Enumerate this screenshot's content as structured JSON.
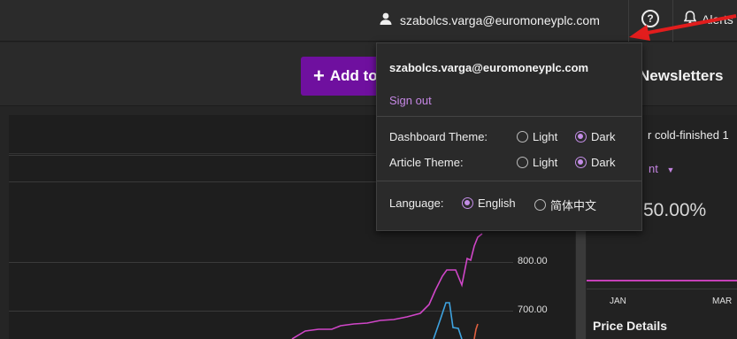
{
  "header": {
    "user_email": "szabolcs.varga@euromoneyplc.com",
    "help_label": "?",
    "alerts_label": "Alerts"
  },
  "toolbar": {
    "add_label": "Add to",
    "newsletters_label": "Newsletters"
  },
  "dropdown": {
    "email": "szabolcs.varga@euromoneyplc.com",
    "sign_out": "Sign out",
    "dashboard_theme": {
      "label": "Dashboard Theme:",
      "options": [
        "Light",
        "Dark"
      ],
      "selected": "Dark"
    },
    "article_theme": {
      "label": "Article Theme:",
      "options": [
        "Light",
        "Dark"
      ],
      "selected": "Dark"
    },
    "language": {
      "label": "Language:",
      "options": [
        "English",
        "简体中文"
      ],
      "selected": "English"
    }
  },
  "chart_panel": {
    "y_labels": [
      "800.00",
      "700.00"
    ]
  },
  "right_panel": {
    "title": "r cold-finished 1",
    "filter": "nt",
    "percent": "50.00%",
    "months": [
      "JAN",
      "MAR"
    ],
    "price_details": "Price Details"
  },
  "chart_data": {
    "type": "line",
    "y_ticks": [
      "800.00",
      "700.00"
    ],
    "series": [
      {
        "color": "#d046c8",
        "values": []
      },
      {
        "color": "#3ea3e0",
        "values": []
      },
      {
        "color": "#e06040",
        "values": []
      }
    ]
  },
  "colors": {
    "accent": "#6f109f",
    "link": "#c587e4",
    "series_magenta": "#d046c8",
    "series_blue": "#3ea3e0"
  }
}
